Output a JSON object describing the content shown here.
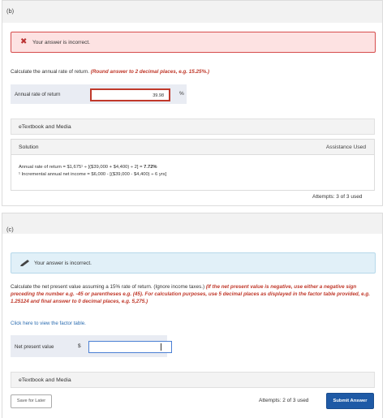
{
  "part_b": {
    "label": "(b)",
    "alert": "Your answer is incorrect.",
    "question": "Calculate the annual rate of return.",
    "hint": "(Round answer to 2 decimal places, e.g. 15.25%.)",
    "answer_label": "Annual rate of return",
    "answer_value": "39.98",
    "unit": "%",
    "etextbook": "eTextbook and Media",
    "solution": {
      "title": "Solution",
      "assistance": "Assistance Used",
      "line1": "Annual rate of return = $1,675¹ ÷ [($39,000 + $4,400) ÷ 2] =",
      "line1_result": "7.72%",
      "line2": "¹ Incremental annual net income = $6,000 - [($39,000 - $4,400) ÷ 6 yrs]"
    },
    "attempts": "Attempts: 3 of 3 used"
  },
  "part_c": {
    "label": "(c)",
    "alert": "Your answer is incorrect.",
    "question": "Calculate the net present value assuming a 15% rate of return. (Ignore income taxes.)",
    "hint": "(If the net present value is negative, use either a negative sign preceding the number e.g. -45 or parentheses e.g. (45). For calculation purposes, use 5 decimal places as displayed in the factor table provided, e.g. 1.25124 and final answer to 0 decimal places, e.g. 5,275.)",
    "link": "Click here to view the factor table.",
    "answer_label": "Net present value",
    "currency": "$",
    "answer_value": "",
    "etextbook": "eTextbook and Media",
    "save_label": "Save for Later",
    "attempts": "Attempts: 2 of 3 used",
    "submit_label": "Submit Answer"
  },
  "colors": {
    "error_border": "#d64c4c",
    "error_bg": "#fde2e2",
    "info_bg": "#e1f0f8",
    "submit_bg": "#1f5aa6",
    "hint_red": "#c0392b",
    "link_blue": "#2b6cb0"
  },
  "icons": {
    "error": "close-icon",
    "info": "pencil-icon"
  }
}
